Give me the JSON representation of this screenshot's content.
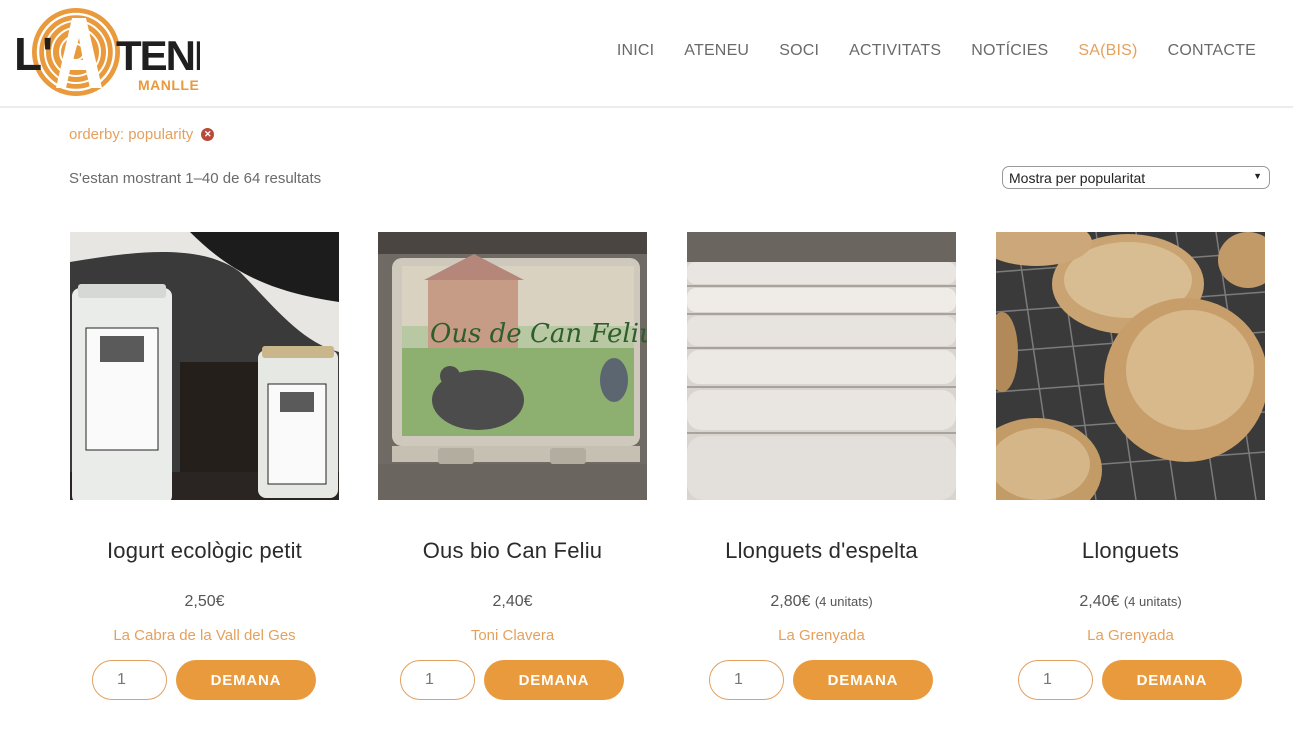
{
  "brand": {
    "logo_main": "L'ATENEU",
    "logo_sub": "MANLLEU"
  },
  "nav": {
    "items": [
      {
        "label": "INICI",
        "active": false
      },
      {
        "label": "ATENEU",
        "active": false
      },
      {
        "label": "SOCI",
        "active": false
      },
      {
        "label": "ACTIVITATS",
        "active": false
      },
      {
        "label": "NOTÍCIES",
        "active": false
      },
      {
        "label": "SA(BIS)",
        "active": true
      },
      {
        "label": "CONTACTE",
        "active": false
      }
    ]
  },
  "filter": {
    "label": "orderby: popularity",
    "remove_icon": "close-circle-icon"
  },
  "results": {
    "count_text": "S'estan mostrant 1–40 de 64 resultats"
  },
  "ordering": {
    "selected": "Mostra per popularitat"
  },
  "products": [
    {
      "title": "Iogurt ecològic petit",
      "price": "2,50€",
      "unit": "",
      "vendor": "La Cabra de la Vall del Ges",
      "qty": "1",
      "button": "DEMANA",
      "image": "yogurt-jars-photo"
    },
    {
      "title": "Ous bio Can Feliu",
      "price": "2,40€",
      "unit": "",
      "vendor": "Toni Clavera",
      "qty": "1",
      "button": "DEMANA",
      "image": "egg-carton-photo"
    },
    {
      "title": "Llonguets d'espelta",
      "price": "2,80€",
      "unit": "(4 unitats)",
      "vendor": "La Grenyada",
      "qty": "1",
      "button": "DEMANA",
      "image": "bread-dough-photo"
    },
    {
      "title": "Llonguets",
      "price": "2,40€",
      "unit": "(4 unitats)",
      "vendor": "La Grenyada",
      "qty": "1",
      "button": "DEMANA",
      "image": "bread-rolls-photo"
    }
  ],
  "colors": {
    "accent": "#e89a3c",
    "link": "#e5a05c",
    "text": "#555555"
  }
}
